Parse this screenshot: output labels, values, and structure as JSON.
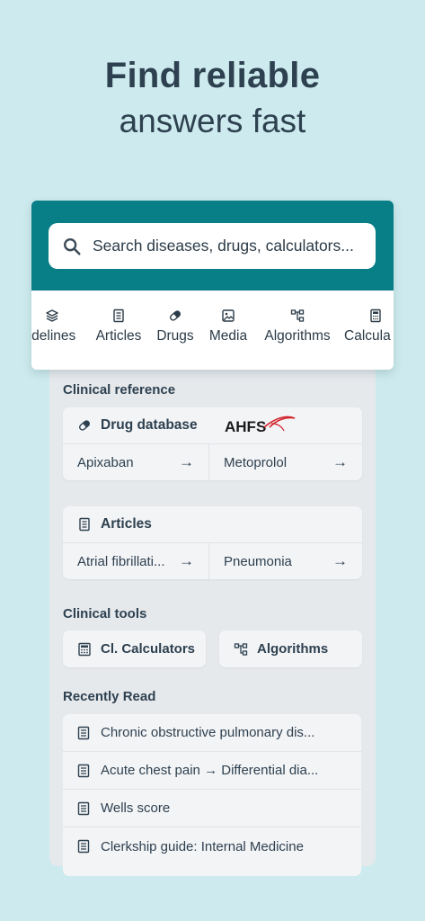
{
  "headline": {
    "line1": "Find reliable",
    "line2": "answers fast"
  },
  "search": {
    "placeholder": "Search diseases, drugs, calculators..."
  },
  "tabs": [
    {
      "label": "idelines",
      "icon": "layers-icon"
    },
    {
      "label": "Articles",
      "icon": "document-icon"
    },
    {
      "label": "Drugs",
      "icon": "pill-icon"
    },
    {
      "label": "Media",
      "icon": "image-icon"
    },
    {
      "label": "Algorithms",
      "icon": "flowchart-icon"
    },
    {
      "label": "Calcula",
      "icon": "calculator-icon"
    }
  ],
  "clinical_reference": {
    "title": "Clinical reference",
    "drug_database": {
      "label": "Drug database",
      "logo": "AHFS",
      "items": [
        "Apixaban",
        "Metoprolol"
      ]
    },
    "articles": {
      "label": "Articles",
      "items": [
        "Atrial fibrillati...",
        "Pneumonia"
      ]
    }
  },
  "clinical_tools": {
    "title": "Clinical tools",
    "items": [
      {
        "label": "Cl. Calculators",
        "icon": "calculator-icon"
      },
      {
        "label": "Algorithms",
        "icon": "flowchart-icon"
      }
    ]
  },
  "recently_read": {
    "title": "Recently Read",
    "items": [
      "Chronic obstructive pulmonary dis...",
      "Acute chest pain → Differential dia...",
      "Wells score",
      "Clerkship guide: Internal Medicine"
    ]
  },
  "arrow": "→",
  "colors": {
    "background": "#cdebee",
    "teal": "#087e86",
    "panel": "#e6e9ec",
    "text": "#2e4150",
    "logo_red": "#d2232a"
  }
}
